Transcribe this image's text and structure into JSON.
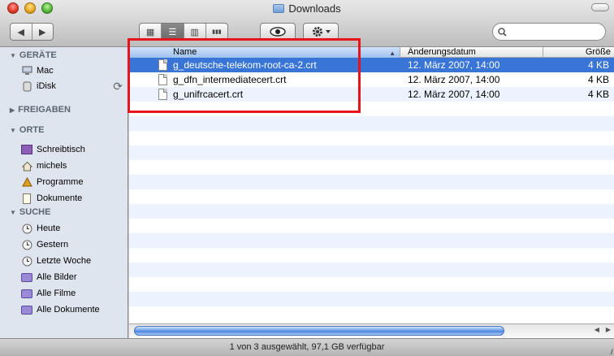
{
  "window": {
    "title": "Downloads"
  },
  "toolbar": {
    "back_icon": "◀",
    "forward_icon": "▶",
    "view_icons": [
      "▦",
      "☰",
      "▥",
      "▮▮▮"
    ],
    "search_placeholder": ""
  },
  "sidebar": {
    "sections": [
      {
        "label": "GERÄTE",
        "expanded": true
      },
      {
        "label": "FREIGABEN",
        "expanded": false
      },
      {
        "label": "ORTE",
        "expanded": true
      },
      {
        "label": "SUCHE",
        "expanded": true
      }
    ],
    "devices": [
      {
        "label": "Mac",
        "icon": "computer-icon"
      },
      {
        "label": "iDisk",
        "icon": "idisk-icon"
      }
    ],
    "places": [
      {
        "label": "Schreibtisch",
        "icon": "desktop-icon"
      },
      {
        "label": "michels",
        "icon": "home-icon"
      },
      {
        "label": "Programme",
        "icon": "applications-icon"
      },
      {
        "label": "Dokumente",
        "icon": "documents-icon"
      }
    ],
    "searches": [
      {
        "label": "Heute",
        "icon": "clock-icon"
      },
      {
        "label": "Gestern",
        "icon": "clock-icon"
      },
      {
        "label": "Letzte Woche",
        "icon": "clock-icon"
      },
      {
        "label": "Alle Bilder",
        "icon": "smart-folder-icon"
      },
      {
        "label": "Alle Filme",
        "icon": "smart-folder-icon"
      },
      {
        "label": "Alle Dokumente",
        "icon": "smart-folder-icon"
      }
    ]
  },
  "columns": {
    "name": "Name",
    "date": "Änderungsdatum",
    "size": "Größe"
  },
  "files": [
    {
      "name": "g_deutsche-telekom-root-ca-2.crt",
      "date": "12. März 2007, 14:00",
      "size": "4 KB",
      "selected": true
    },
    {
      "name": "g_dfn_intermediatecert.crt",
      "date": "12. März 2007, 14:00",
      "size": "4 KB",
      "selected": false
    },
    {
      "name": "g_unifrcacert.crt",
      "date": "12. März 2007, 14:00",
      "size": "4 KB",
      "selected": false
    }
  ],
  "status": {
    "text": "1 von 3 ausgewählt, 97,1 GB verfügbar"
  },
  "colors": {
    "selection": "#3875d7",
    "highlight_box": "#e8141c",
    "sidebar_bg": "#dfe5ee"
  }
}
